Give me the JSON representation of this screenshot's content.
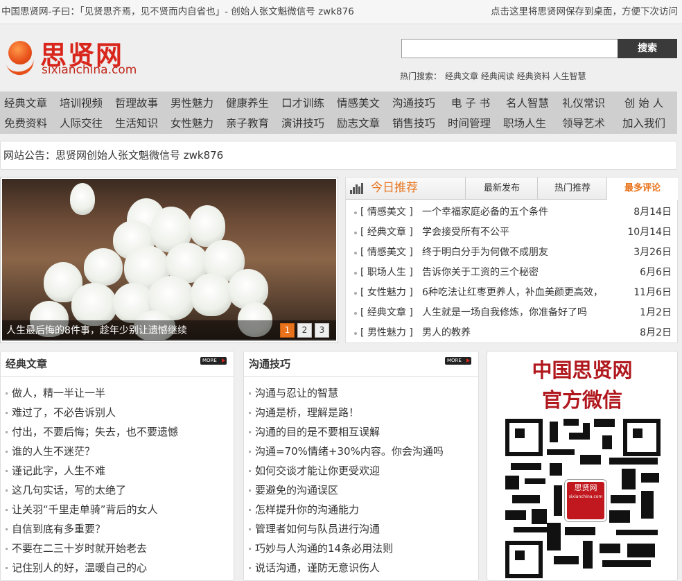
{
  "topbar": {
    "left_text": "中国思贤网-子曰：「见贤思齐焉，见不贤而内自省也」- 创始人张文魁微信号 zwk876",
    "right_text": "点击这里将思贤网保存到桌面，方便下次访问"
  },
  "header": {
    "logo_cn": "思贤网",
    "logo_en": "sixianchina.com",
    "search_value": "",
    "search_button": "搜索",
    "hot_label": "热门搜索：",
    "hot_links": [
      "经典文章",
      "经典阅读",
      "经典资料",
      "人生智慧"
    ]
  },
  "nav": {
    "row1": [
      "经典文章",
      "培训视频",
      "哲理故事",
      "男性魅力",
      "健康养生",
      "口才训练",
      "情感美文",
      "沟通技巧",
      "电 子 书",
      "名人智慧",
      "礼仪常识",
      "创 始 人"
    ],
    "row2": [
      "免费资料",
      "人际交往",
      "生活知识",
      "女性魅力",
      "亲子教育",
      "演讲技巧",
      "励志文章",
      "销售技巧",
      "时间管理",
      "职场人生",
      "领导艺术",
      "加入我们"
    ]
  },
  "notice": {
    "text": "网站公告：思贤网创始人张文魁微信号 zwk876"
  },
  "slideshow": {
    "caption": "人生最后悔的8件事，趁年少别让遗憾继续",
    "pages": [
      "1",
      "2",
      "3"
    ],
    "active_page": 1
  },
  "today": {
    "title": "今日推荐",
    "tabs": [
      "最新发布",
      "热门推荐",
      "最多评论"
    ],
    "active_tab": "最多评论",
    "items": [
      {
        "cat": "[ 情感美文 ]",
        "title": "一个幸福家庭必备的五个条件",
        "date": "8月14日"
      },
      {
        "cat": "[ 经典文章 ]",
        "title": "学会接受所有不公平",
        "date": "10月14日"
      },
      {
        "cat": "[ 情感美文 ]",
        "title": "终于明白分手为何做不成朋友",
        "date": "3月26日"
      },
      {
        "cat": "[ 职场人生 ]",
        "title": "告诉你关于工资的三个秘密",
        "date": "6月6日"
      },
      {
        "cat": "[ 女性魅力 ]",
        "title": "6种吃法让红枣更养人，补血美颜更高效，",
        "date": "11月6日"
      },
      {
        "cat": "[ 经典文章 ]",
        "title": "人生就是一场自我修炼，你准备好了吗",
        "date": "1月2日"
      },
      {
        "cat": "[ 男性魅力 ]",
        "title": "男人的教养",
        "date": "8月2日"
      }
    ]
  },
  "classic_box": {
    "title": "经典文章",
    "more": "MORE",
    "items": [
      "做人，精一半让一半",
      "难过了，不必告诉别人",
      "付出，不要后悔；失去，也不要遗憾",
      "谁的人生不迷茫？",
      "谨记此字，人生不难",
      "这几句实话，写的太绝了",
      "让关羽“千里走单骑”背后的女人",
      "自信到底有多重要？",
      "不要在二三十岁时就开始老去",
      "记住别人的好，温暖自己的心"
    ]
  },
  "comm_box": {
    "title": "沟通技巧",
    "more": "MORE",
    "items": [
      "沟通与忍让的智慧",
      "沟通是桥，理解是路！",
      "沟通的目的是不要相互误解",
      "沟通=70%情绪+30%内容。你会沟通吗",
      "如何交谈才能让你更受欢迎",
      "要避免的沟通误区",
      "怎样提升你的沟通能力",
      "管理者如何与队员进行沟通",
      "巧妙与人沟通的14条必用法则",
      "说话沟通，谨防无意识伤人"
    ]
  },
  "wechat": {
    "line1": "中国思贤网",
    "line2": "官方微信",
    "qr_center": "思贤网",
    "qr_center_small": "sixianchina.com"
  },
  "colors": {
    "accent_orange": "#e8731c",
    "brand_red": "#d9261c",
    "wechat_red": "#b0181e"
  }
}
